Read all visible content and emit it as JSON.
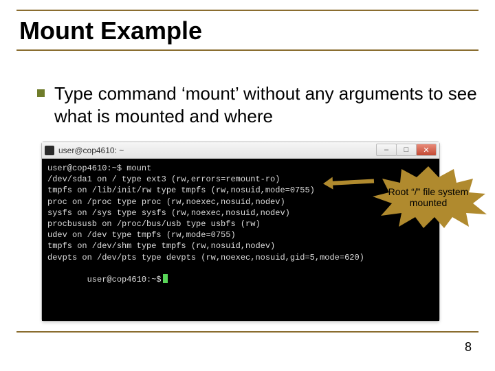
{
  "title": "Mount Example",
  "bullet": "Type command ‘mount’ without any arguments to see what is mounted and where",
  "terminal": {
    "window_title": "user@cop4610: ~",
    "controls": {
      "min": "–",
      "max": "□",
      "close": "✕"
    },
    "lines": [
      "user@cop4610:~$ mount",
      "/dev/sda1 on / type ext3 (rw,errors=remount-ro)",
      "tmpfs on /lib/init/rw type tmpfs (rw,nosuid,mode=0755)",
      "proc on /proc type proc (rw,noexec,nosuid,nodev)",
      "sysfs on /sys type sysfs (rw,noexec,nosuid,nodev)",
      "procbususb on /proc/bus/usb type usbfs (rw)",
      "udev on /dev type tmpfs (rw,mode=0755)",
      "tmpfs on /dev/shm type tmpfs (rw,nosuid,nodev)",
      "devpts on /dev/pts type devpts (rw,noexec,nosuid,gid=5,mode=620)",
      "user@cop4610:~$"
    ]
  },
  "callout": {
    "line1": "Root “/” file system",
    "line2": "mounted"
  },
  "page_number": "8",
  "colors": {
    "accent_rule": "#8a6d2f",
    "bullet": "#6f7c2a",
    "starburst_fill": "#b08a2e",
    "terminal_bg": "#000000"
  }
}
